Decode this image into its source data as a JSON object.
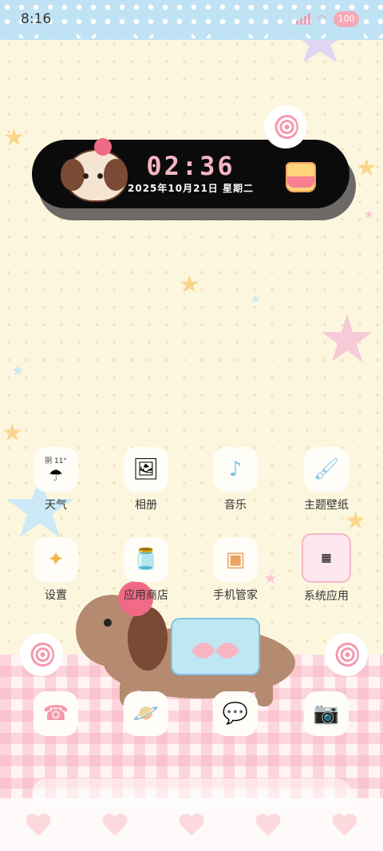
{
  "status_bar": {
    "time": "8:16",
    "battery": "100"
  },
  "clock_widget": {
    "time": "02:36",
    "date": "2025年10月21日 星期二"
  },
  "apps_row1": [
    {
      "label": "天气",
      "icon": "umbrella-weather-icon",
      "badge": "阴 11°"
    },
    {
      "label": "相册",
      "icon": "photo-album-icon"
    },
    {
      "label": "音乐",
      "icon": "music-note-icon"
    },
    {
      "label": "主题壁纸",
      "icon": "paint-roller-icon"
    }
  ],
  "apps_row2": [
    {
      "label": "设置",
      "icon": "settings-wand-icon"
    },
    {
      "label": "应用商店",
      "icon": "app-store-jar-icon"
    },
    {
      "label": "手机管家",
      "icon": "phone-manager-icon"
    },
    {
      "label": "系统应用",
      "icon": "system-apps-folder-icon"
    }
  ],
  "dock": [
    {
      "icon": "phone-icon"
    },
    {
      "icon": "browser-planet-icon"
    },
    {
      "icon": "messages-bubble-icon"
    },
    {
      "icon": "camera-icon"
    }
  ],
  "colors": {
    "status_bar_bg": "#bfe3f5",
    "wallpaper": "#fdf6df",
    "accent_pink": "#f7b5c4"
  }
}
